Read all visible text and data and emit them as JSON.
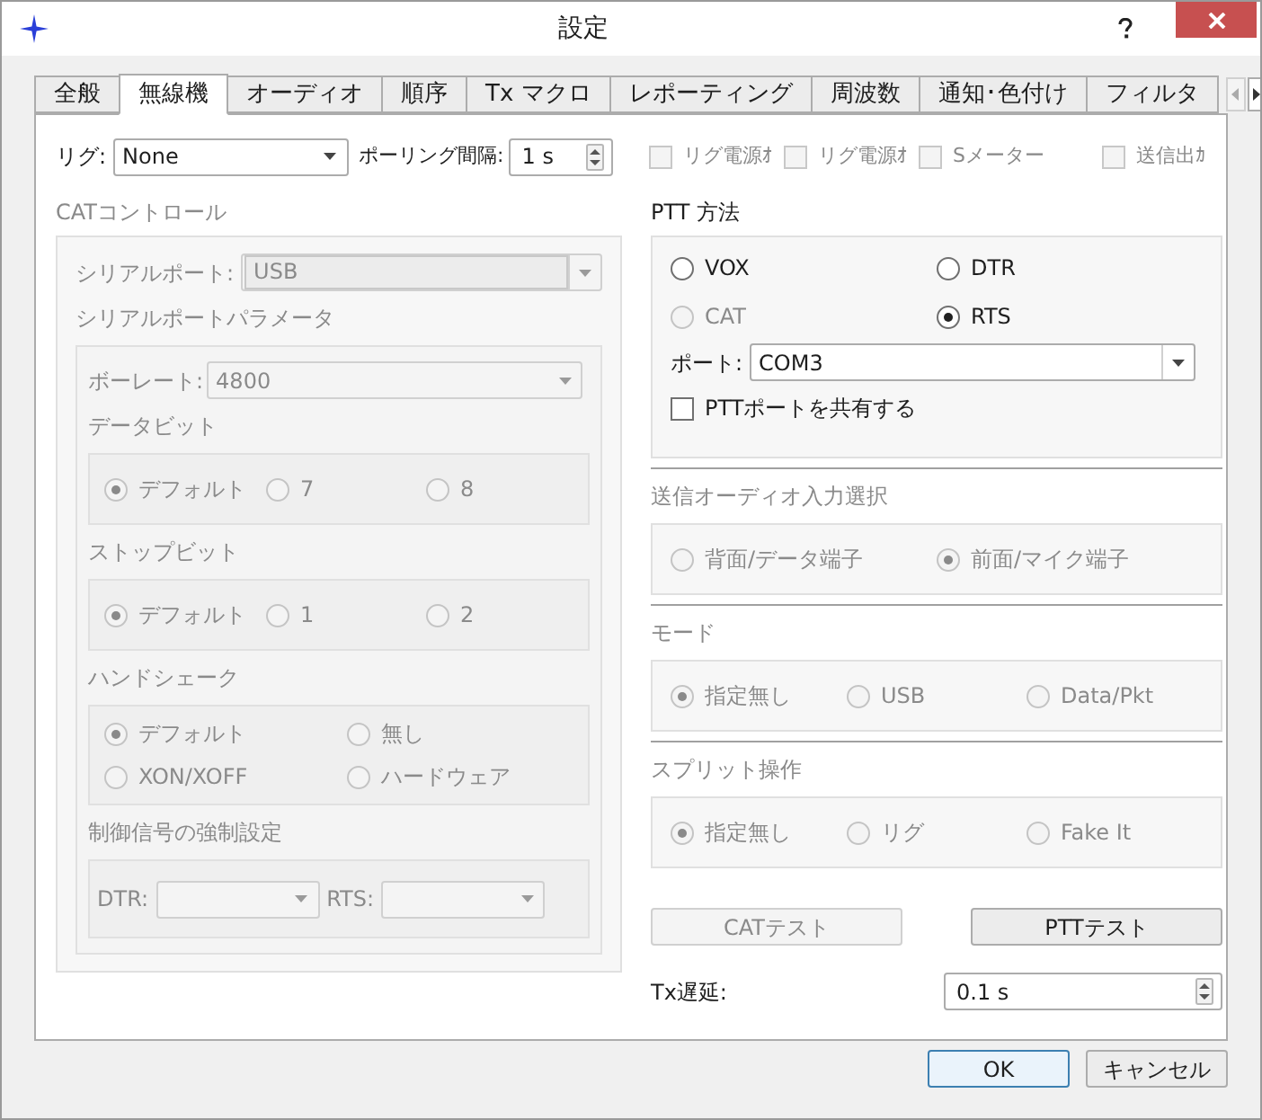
{
  "window": {
    "title": "設定"
  },
  "tabs": [
    {
      "label": "全般",
      "selected": false
    },
    {
      "label": "無線機",
      "selected": true
    },
    {
      "label": "オーディオ",
      "selected": false
    },
    {
      "label": "順序",
      "selected": false
    },
    {
      "label": "Tx マクロ",
      "selected": false
    },
    {
      "label": "レポーティング",
      "selected": false
    },
    {
      "label": "周波数",
      "selected": false
    },
    {
      "label": "通知･色付け",
      "selected": false
    },
    {
      "label": "フィルタ",
      "selected": false
    }
  ],
  "rig": {
    "label": "リグ:",
    "value": "None"
  },
  "polling": {
    "label": "ポーリング間隔:",
    "value": "1 s"
  },
  "options": [
    {
      "label": "リグ電源ｵ",
      "checked": false,
      "disabled": true
    },
    {
      "label": "リグ電源ｵ",
      "checked": false,
      "disabled": true
    },
    {
      "label": "Sメーター",
      "checked": false,
      "disabled": true
    },
    {
      "label": "送信出ｶ",
      "checked": false,
      "disabled": true
    }
  ],
  "cat_control": {
    "title": "CATコントロール",
    "serial_port": {
      "label": "シリアルポート:",
      "value": "USB",
      "disabled": true
    },
    "params_title": "シリアルポートパラメータ",
    "baud": {
      "label": "ボーレート:",
      "value": "4800",
      "disabled": true
    },
    "data_bits": {
      "title": "データビット",
      "options": [
        {
          "label": "デフォルト",
          "selected": true,
          "disabled": true
        },
        {
          "label": "7",
          "selected": false,
          "disabled": true
        },
        {
          "label": "8",
          "selected": false,
          "disabled": true
        }
      ]
    },
    "stop_bits": {
      "title": "ストップビット",
      "options": [
        {
          "label": "デフォルト",
          "selected": true,
          "disabled": true
        },
        {
          "label": "1",
          "selected": false,
          "disabled": true
        },
        {
          "label": "2",
          "selected": false,
          "disabled": true
        }
      ]
    },
    "handshake": {
      "title": "ハンドシェーク",
      "options": [
        {
          "label": "デフォルト",
          "selected": true,
          "disabled": true
        },
        {
          "label": "無し",
          "selected": false,
          "disabled": true
        },
        {
          "label": "XON/XOFF",
          "selected": false,
          "disabled": true
        },
        {
          "label": "ハードウェア",
          "selected": false,
          "disabled": true
        }
      ]
    },
    "force": {
      "title": "制御信号の強制設定",
      "dtr_label": "DTR:",
      "rts_label": "RTS:"
    }
  },
  "ptt": {
    "title": "PTT 方法",
    "options": [
      {
        "label": "VOX",
        "selected": false,
        "disabled": false
      },
      {
        "label": "DTR",
        "selected": false,
        "disabled": false
      },
      {
        "label": "CAT",
        "selected": false,
        "disabled": true
      },
      {
        "label": "RTS",
        "selected": true,
        "disabled": false
      }
    ],
    "port": {
      "label": "ポート:",
      "value": "COM3"
    },
    "share": {
      "label": "PTTポートを共有する",
      "checked": false
    }
  },
  "groups": [
    {
      "title": "送信オーディオ入力選択",
      "options": [
        {
          "label": "背面/データ端子",
          "selected": false,
          "disabled": true
        },
        {
          "label": "前面/マイク端子",
          "selected": true,
          "disabled": true
        }
      ]
    },
    {
      "title": "モード",
      "options": [
        {
          "label": "指定無し",
          "selected": true,
          "disabled": true
        },
        {
          "label": "USB",
          "selected": false,
          "disabled": true
        },
        {
          "label": "Data/Pkt",
          "selected": false,
          "disabled": true
        }
      ]
    },
    {
      "title": "スプリット操作",
      "options": [
        {
          "label": "指定無し",
          "selected": true,
          "disabled": true
        },
        {
          "label": "リグ",
          "selected": false,
          "disabled": true
        },
        {
          "label": "Fake It",
          "selected": false,
          "disabled": true
        }
      ]
    }
  ],
  "test_buttons": [
    {
      "label": "CATテスト",
      "disabled": true
    },
    {
      "label": "PTTテスト",
      "disabled": false
    }
  ],
  "tx_delay": {
    "label": "Tx遅延:",
    "value": "0.1 s"
  },
  "footer_buttons": [
    {
      "label": "OK",
      "default": true
    },
    {
      "label": "キャンセル",
      "default": false
    }
  ]
}
